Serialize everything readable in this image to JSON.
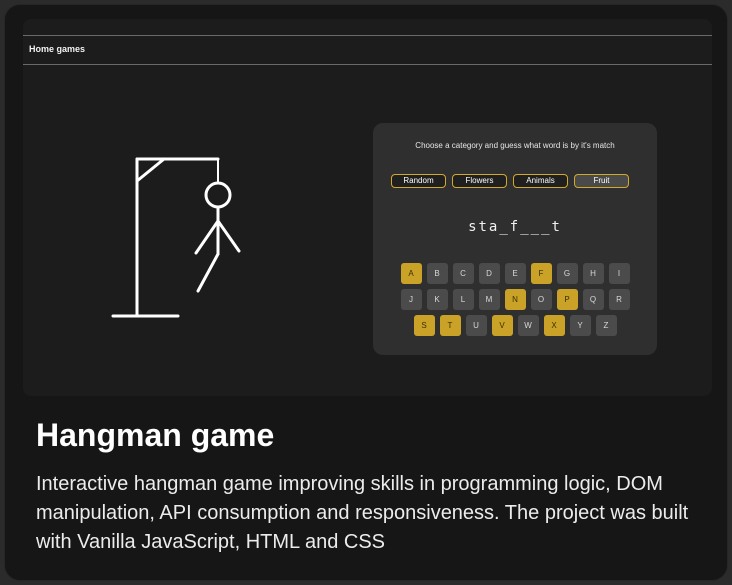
{
  "preview": {
    "nav_title": "Home games",
    "prompt": "Choose a category and guess what word is by it's match",
    "categories": [
      {
        "label": "Random",
        "active": false
      },
      {
        "label": "Flowers",
        "active": false
      },
      {
        "label": "Animals",
        "active": false
      },
      {
        "label": "Fruit",
        "active": true
      }
    ],
    "word": "sta_f___t",
    "keyboard_rows": [
      [
        "A",
        "B",
        "C",
        "D",
        "E",
        "F",
        "G",
        "H",
        "I"
      ],
      [
        "J",
        "K",
        "L",
        "M",
        "N",
        "O",
        "P",
        "Q",
        "R"
      ],
      [
        "S",
        "T",
        "U",
        "V",
        "W",
        "X",
        "Y",
        "Z"
      ]
    ],
    "used_letters": [
      "A",
      "F",
      "N",
      "P",
      "S",
      "T",
      "V",
      "X"
    ]
  },
  "card": {
    "title": "Hangman game",
    "description": "Interactive hangman game improving skills in programming logic, DOM manipulation, API consumption and responsiveness. The project was built with Vanilla JavaScript, HTML and CSS"
  },
  "colors": {
    "accent": "#c9a227",
    "card_bg": "#161616",
    "key_bg": "#4b4b4b"
  }
}
